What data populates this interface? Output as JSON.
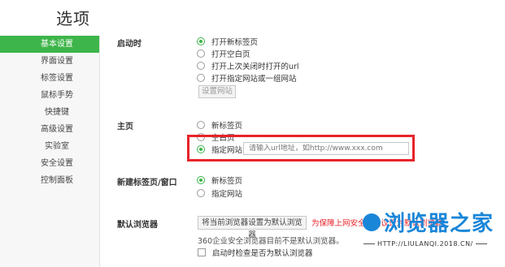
{
  "page": {
    "title": "选项"
  },
  "sidebar": {
    "items": [
      {
        "label": "基本设置",
        "active": true
      },
      {
        "label": "界面设置"
      },
      {
        "label": "标签设置"
      },
      {
        "label": "鼠标手势"
      },
      {
        "label": "快捷键"
      },
      {
        "label": "高级设置"
      },
      {
        "label": "实验室"
      },
      {
        "label": "安全设置"
      },
      {
        "label": "控制面板"
      }
    ]
  },
  "startup": {
    "label": "启动时",
    "options": [
      "打开新标签页",
      "打开空白页",
      "打开上次关闭时打开的url",
      "打开指定网站或一组网站"
    ],
    "selected": 0,
    "set_sites_button": "设置网站"
  },
  "homepage": {
    "label": "主页",
    "options": [
      "新标签页",
      "空白页",
      "指定网站"
    ],
    "selected": 2,
    "url_placeholder": "请输入url地址，如http://www.xxx.com"
  },
  "new_tab": {
    "label": "新建标签页/窗口",
    "options": [
      "新标签页",
      "指定网站"
    ],
    "selected": 0
  },
  "default_browser": {
    "label": "默认浏览器",
    "set_button": "将当前浏览器设置为默认浏览器",
    "note": "为保障上网安全，建议设为默认浏览器",
    "status": "360企业安全浏览器目前不是默认浏览器。",
    "check_label": "启动时检查是否为默认浏览器",
    "check_on": false
  },
  "brand": {
    "name": "浏览器之家",
    "url": "HTTP://LIULANQI.2018.CN/"
  },
  "colors": {
    "accent": "#3db54a",
    "highlight": "#e8232a",
    "brand": "#1a86d8"
  }
}
